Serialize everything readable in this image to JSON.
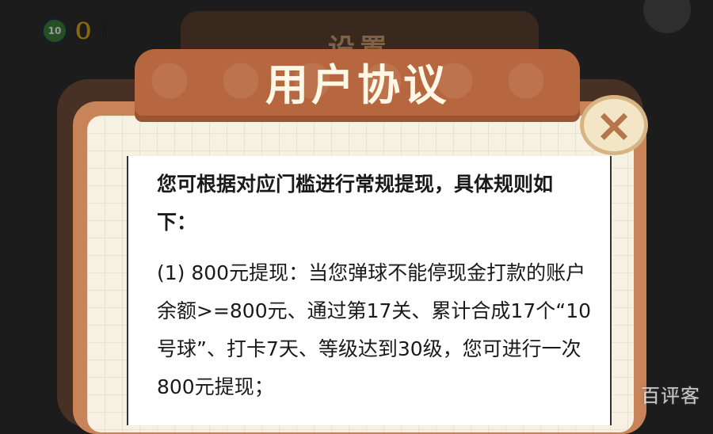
{
  "hud": {
    "ball_label": "10",
    "count": "0个"
  },
  "background_panel": {
    "title": "设置"
  },
  "dialog": {
    "title": "用户协议",
    "close_symbol": "×",
    "intro": "您可根据对应门槛进行常规提现，具体规则如下：",
    "rule_1": "(1) 800元提现：当您弹球不能停现金打款的账户余额>=800元、通过第17关、累计合成17个“10号球”、打卡7天、等级达到30级，您可进行一次800元提现；"
  },
  "watermark": "百评客",
  "colors": {
    "banner": "#b7673f",
    "frame": "#c88358",
    "sheet": "#ffffff",
    "title_text": "#fff8e6"
  },
  "icons": {
    "close": "close-icon",
    "ball": "ball-icon",
    "settings": "gear-icon"
  }
}
